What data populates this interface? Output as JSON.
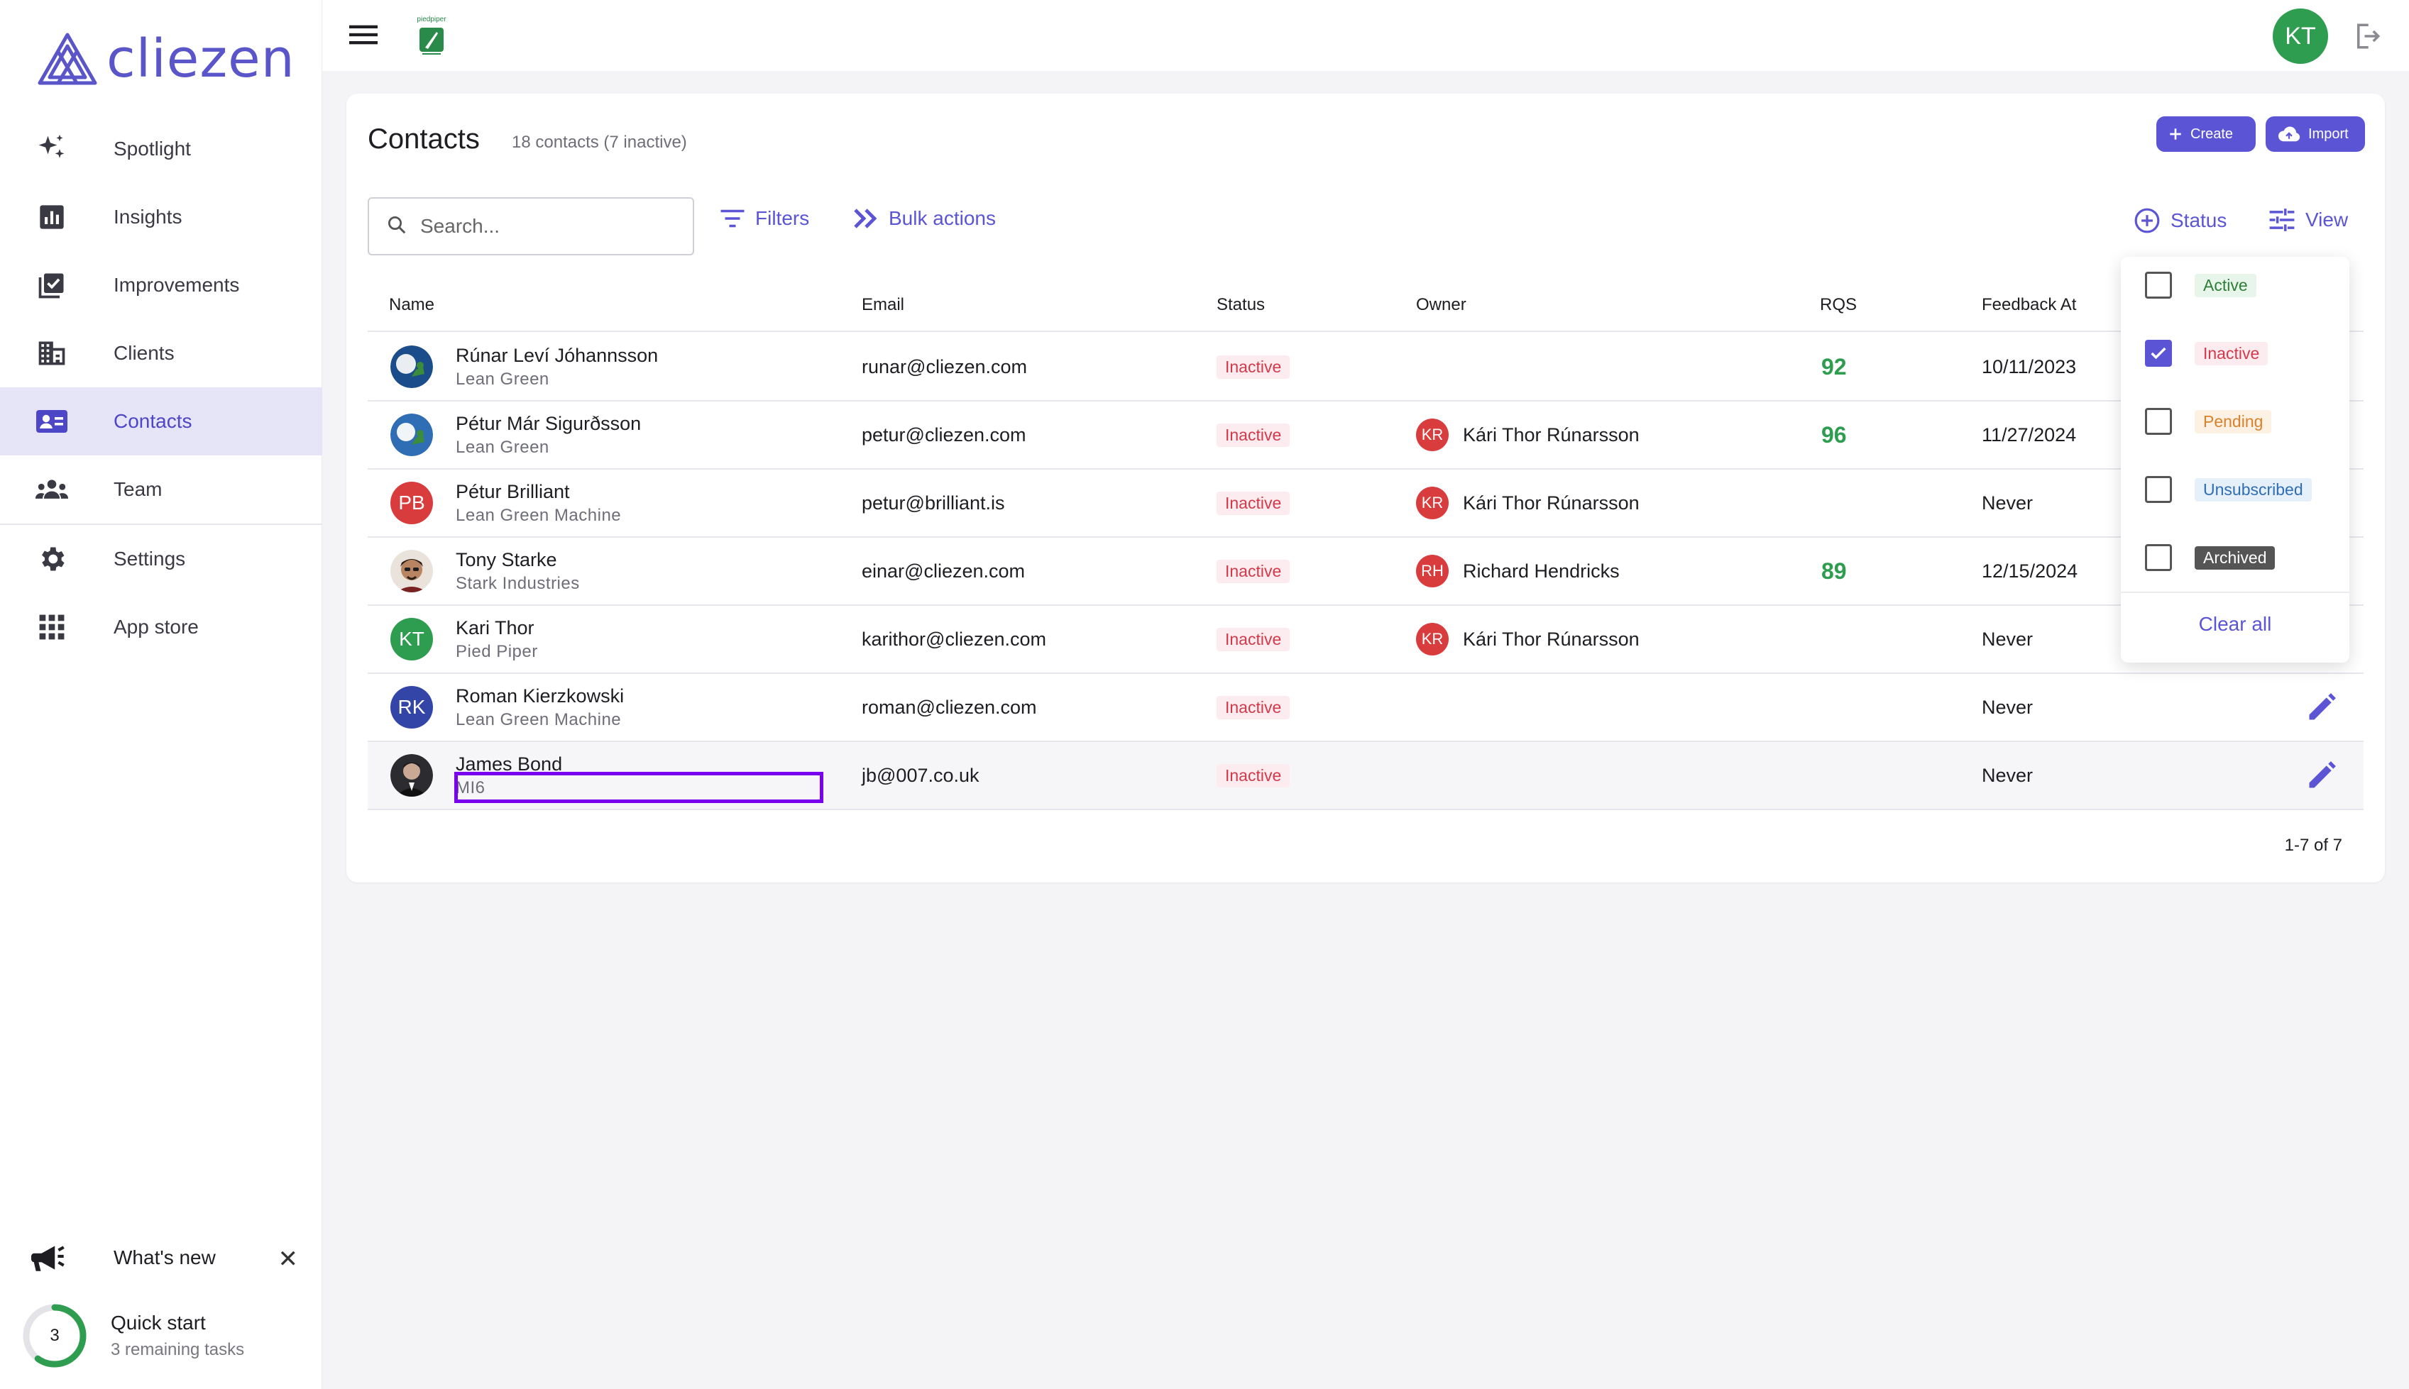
{
  "brand": {
    "name": "cliezen",
    "color": "#5a55c9"
  },
  "sidebar": {
    "items": [
      {
        "label": "Spotlight",
        "icon": "sparkles-icon"
      },
      {
        "label": "Insights",
        "icon": "bar-chart-icon"
      },
      {
        "label": "Improvements",
        "icon": "checklist-icon"
      },
      {
        "label": "Clients",
        "icon": "building-icon"
      },
      {
        "label": "Contacts",
        "icon": "contact-card-icon",
        "active": true
      },
      {
        "label": "Team",
        "icon": "group-icon"
      },
      {
        "label": "Settings",
        "icon": "gear-icon"
      },
      {
        "label": "App store",
        "icon": "apps-grid-icon"
      }
    ],
    "whats_new": "What's new",
    "quick_start": {
      "title": "Quick start",
      "subtitle": "3 remaining tasks",
      "count": "3",
      "progress": 0.6
    }
  },
  "topbar": {
    "workspace_label": "piedpiper",
    "user_initials": "KT"
  },
  "page": {
    "title": "Contacts",
    "subtitle": "18 contacts (7 inactive)",
    "create_label": "Create",
    "import_label": "Import",
    "search_placeholder": "Search...",
    "filters_label": "Filters",
    "bulk_label": "Bulk actions",
    "status_label": "Status",
    "view_label": "View",
    "pager": "1-7 of 7"
  },
  "table": {
    "columns": [
      "Name",
      "Email",
      "Status",
      "Owner",
      "RQS",
      "Feedback At"
    ],
    "rows": [
      {
        "name": "Rúnar Leví Jóhannsson",
        "company": "Lean Green",
        "email": "runar@cliezen.com",
        "status": "Inactive",
        "owner": "",
        "owner_initials": "",
        "rqs": "92",
        "feedback": "10/11/2023",
        "avatar": "photo"
      },
      {
        "name": "Pétur Már Sigurðsson",
        "company": "Lean Green",
        "email": "petur@cliezen.com",
        "status": "Inactive",
        "owner": "Kári Thor Rúnarsson",
        "owner_initials": "KR",
        "rqs": "96",
        "feedback": "11/27/2024",
        "avatar": "photo"
      },
      {
        "name": "Pétur Brilliant",
        "company": "Lean Green Machine",
        "email": "petur@brilliant.is",
        "status": "Inactive",
        "owner": "Kári Thor Rúnarsson",
        "owner_initials": "KR",
        "rqs": "",
        "feedback": "Never",
        "avatar": "PB",
        "avatar_color": "#d93c3c"
      },
      {
        "name": "Tony Starke",
        "company": "Stark Industries",
        "email": "einar@cliezen.com",
        "status": "Inactive",
        "owner": "Richard Hendricks",
        "owner_initials": "RH",
        "rqs": "89",
        "feedback": "12/15/2024",
        "avatar": "photo"
      },
      {
        "name": "Kari Thor",
        "company": "Pied Piper",
        "email": "karithor@cliezen.com",
        "status": "Inactive",
        "owner": "Kári Thor Rúnarsson",
        "owner_initials": "KR",
        "rqs": "",
        "feedback": "Never",
        "avatar": "KT",
        "avatar_color": "#2e9d4f"
      },
      {
        "name": "Roman Kierzkowski",
        "company": "Lean Green Machine",
        "email": "roman@cliezen.com",
        "status": "Inactive",
        "owner": "",
        "owner_initials": "",
        "rqs": "",
        "feedback": "Never",
        "avatar": "RK",
        "avatar_color": "#3346a8"
      },
      {
        "name": "James Bond",
        "company": "MI6",
        "email": "jb@007.co.uk",
        "status": "Inactive",
        "owner": "",
        "owner_initials": "",
        "rqs": "",
        "feedback": "Never",
        "avatar": "photo"
      }
    ]
  },
  "status_filter": {
    "options": [
      {
        "label": "Active",
        "checked": false,
        "bg": "#e8f5ea",
        "fg": "#2e7d3a"
      },
      {
        "label": "Inactive",
        "checked": true,
        "bg": "#fdecef",
        "fg": "#d23a4b"
      },
      {
        "label": "Pending",
        "checked": false,
        "bg": "#fdf1e3",
        "fg": "#d9822b"
      },
      {
        "label": "Unsubscribed",
        "checked": false,
        "bg": "#e6f0fb",
        "fg": "#2f6db5"
      },
      {
        "label": "Archived",
        "checked": false,
        "bg": "#555555",
        "fg": "#ffffff"
      }
    ],
    "clear_label": "Clear all"
  },
  "colors": {
    "accent": "#5b55d6",
    "positive": "#2e9d4f",
    "danger": "#d23a4b"
  }
}
